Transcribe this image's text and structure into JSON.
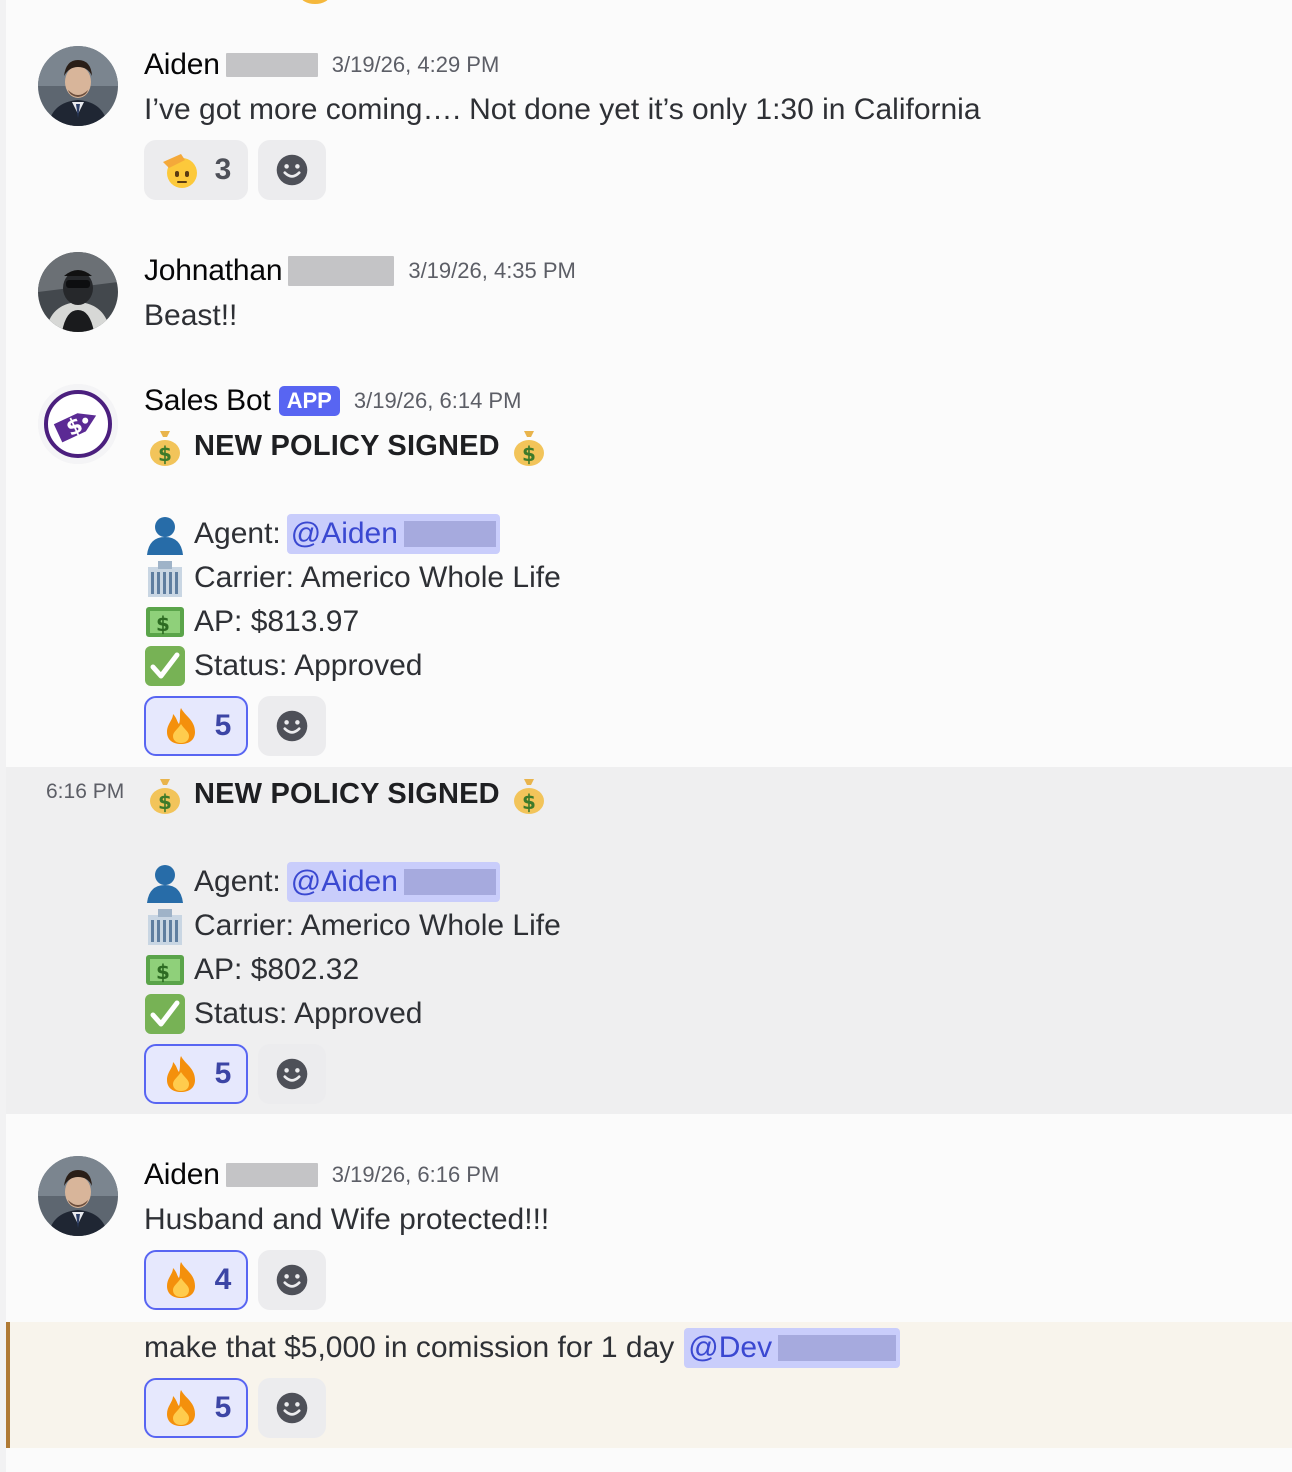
{
  "messages": [
    {
      "author": "Aiden",
      "timestamp": "3/19/26, 4:29 PM",
      "text": "I’ve got more coming…. Not done yet it’s only 1:30 in California",
      "reactions": [
        {
          "emoji": "saluting-face",
          "count": "3"
        }
      ]
    },
    {
      "author": "Johnathan",
      "timestamp": "3/19/26, 4:35 PM",
      "text": "Beast!!"
    },
    {
      "author": "Sales Bot",
      "tag": "APP",
      "timestamp": "3/19/26, 6:14 PM",
      "title": "NEW POLICY SIGNED",
      "agent_label": "Agent:",
      "agent_mention": "@Aiden",
      "carrier": "Carrier: Americo Whole Life",
      "ap": "AP: $813.97",
      "status": "Status: Approved",
      "reactions": [
        {
          "emoji": "fire",
          "count": "5"
        }
      ]
    },
    {
      "hover_timestamp": "6:16 PM",
      "title": "NEW POLICY SIGNED",
      "agent_label": "Agent:",
      "agent_mention": "@Aiden",
      "carrier": "Carrier: Americo Whole Life",
      "ap": "AP: $802.32",
      "status": "Status: Approved",
      "reactions": [
        {
          "emoji": "fire",
          "count": "5"
        }
      ]
    },
    {
      "author": "Aiden",
      "timestamp": "3/19/26, 6:16 PM",
      "text": "Husband and Wife protected!!!",
      "reactions": [
        {
          "emoji": "fire",
          "count": "4"
        }
      ]
    },
    {
      "text": "make that $5,000 in comission for 1 day",
      "mention": "@Dev",
      "reactions": [
        {
          "emoji": "fire",
          "count": "5"
        }
      ]
    }
  ],
  "icons": {
    "saluting": "saluting-face-icon",
    "fire": "fire-icon",
    "add_reaction": "smiley-add-icon",
    "money_bag": "money-bag-icon",
    "agent": "bust-silhouette-icon",
    "carrier": "office-building-icon",
    "ap": "dollar-banknote-icon",
    "status": "check-mark-button-icon"
  },
  "colors": {
    "accent": "#5865f2",
    "mention_bg": "#c9cdfb",
    "highlight_bar": "#b07a35"
  }
}
